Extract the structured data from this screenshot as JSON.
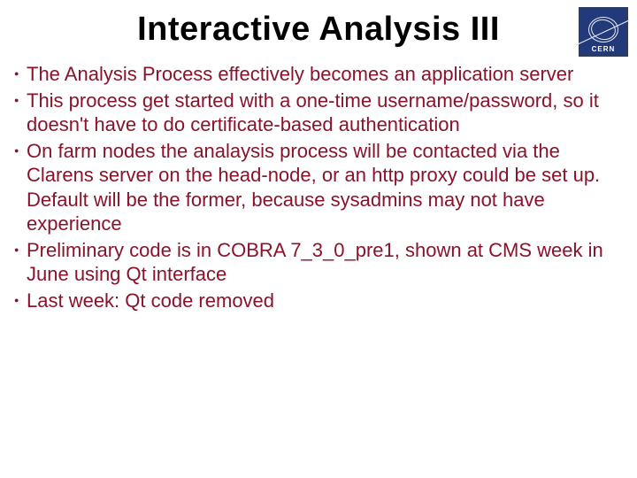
{
  "title": "Interactive Analysis III",
  "logo": {
    "label": "CERN"
  },
  "bullets": [
    "The Analysis Process effectively becomes an application server",
    "This process get started with a one-time username/password, so it doesn't have to do certificate-based authentication",
    "On farm nodes the analaysis process will be contacted via the Clarens server on the head-node, or an http proxy could be set up. Default will be the former, because sysadmins may not have experience",
    "Preliminary code is in COBRA 7_3_0_pre1, shown at CMS week in June using Qt interface",
    "Last week: Qt code removed"
  ]
}
